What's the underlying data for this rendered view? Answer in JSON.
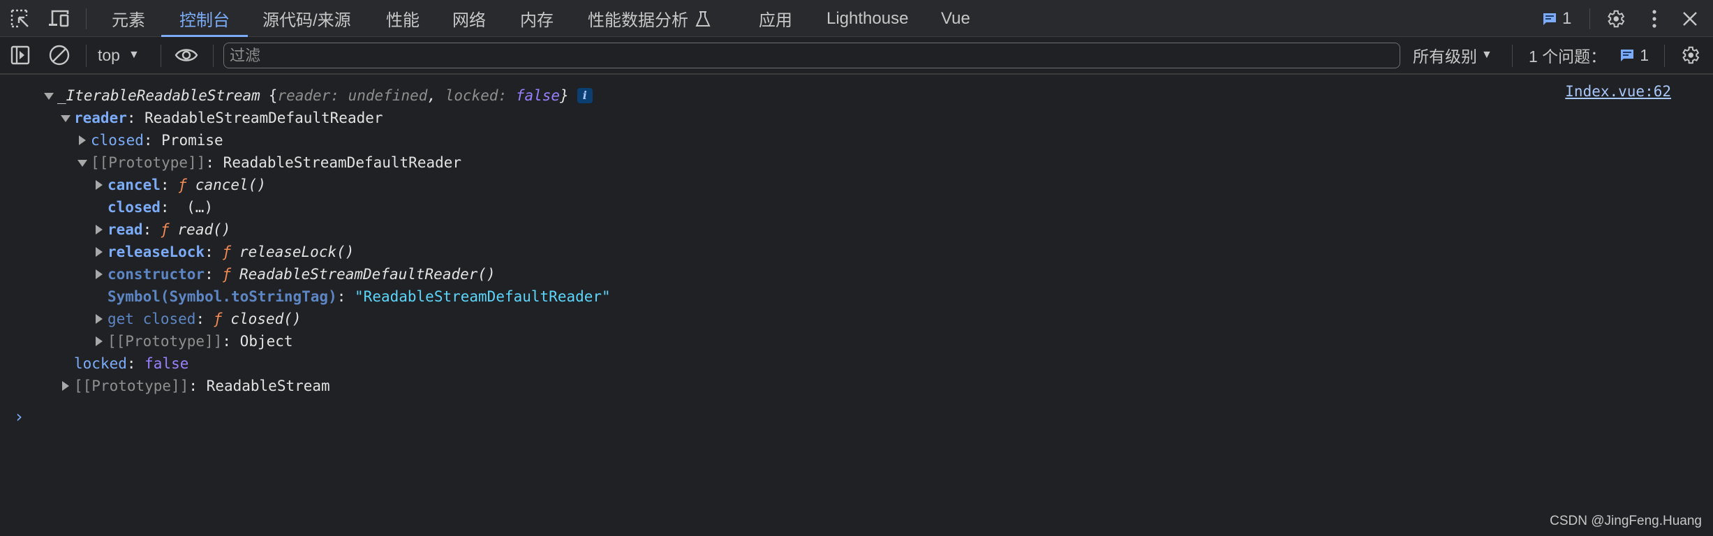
{
  "tabbar": {
    "inspect_icon": "inspect-element-icon",
    "device_icon": "device-toolbar-icon",
    "tabs": [
      {
        "label": "元素"
      },
      {
        "label": "控制台",
        "active": true
      },
      {
        "label": "源代码/来源"
      },
      {
        "label": "性能"
      },
      {
        "label": "网络"
      },
      {
        "label": "内存"
      },
      {
        "label": "性能数据分析",
        "icon": "flask-icon"
      },
      {
        "label": "应用"
      },
      {
        "label": "Lighthouse"
      },
      {
        "label": "Vue"
      }
    ],
    "issues_count": "1",
    "accent_color": "#7cacf8"
  },
  "toolbar": {
    "context": "top",
    "filter_placeholder": "过滤",
    "filter_value": "",
    "level": "所有级别",
    "issues_label": "1 个问题：",
    "issues_count": "1"
  },
  "console": {
    "source_link": "Index.vue:62",
    "summary": {
      "class_name": "_IterableReadableStream",
      "open": "{",
      "k1": "reader",
      "v1": "undefined",
      "sep": ", ",
      "k2": "locked",
      "v2": "false",
      "close": "}",
      "info": "i"
    },
    "rows": {
      "reader": {
        "key": "reader",
        "value": "ReadableStreamDefaultReader"
      },
      "closed": {
        "key": "closed",
        "value": "Promise"
      },
      "proto1": {
        "key": "[[Prototype]]",
        "value": "ReadableStreamDefaultReader"
      },
      "cancel": {
        "key": "cancel",
        "f": "ƒ",
        "fn": "cancel()"
      },
      "closed_getter": {
        "key": "closed",
        "value": "(…)"
      },
      "read": {
        "key": "read",
        "f": "ƒ",
        "fn": "read()"
      },
      "releaseLock": {
        "key": "releaseLock",
        "f": "ƒ",
        "fn": "releaseLock()"
      },
      "constructor": {
        "key": "constructor",
        "f": "ƒ",
        "fn": "ReadableStreamDefaultReader()"
      },
      "tag": {
        "key": "Symbol(Symbol.toStringTag)",
        "value": "\"ReadableStreamDefaultReader\""
      },
      "get_closed": {
        "key": "get closed",
        "f": "ƒ",
        "fn": "closed()"
      },
      "proto2": {
        "key": "[[Prototype]]",
        "value": "Object"
      },
      "locked": {
        "key": "locked",
        "value": "false"
      },
      "proto3": {
        "key": "[[Prototype]]",
        "value": "ReadableStream"
      }
    },
    "colon": ": ",
    "prompt": "›"
  },
  "watermark": "CSDN @JingFeng.Huang"
}
